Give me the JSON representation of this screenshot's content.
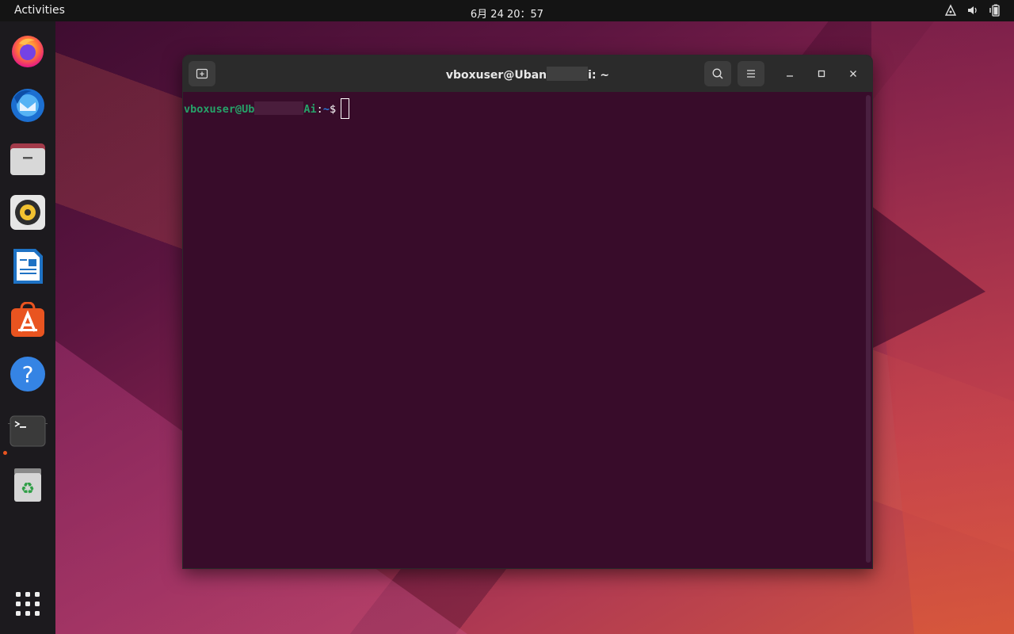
{
  "topbar": {
    "activities_label": "Activities",
    "clock": "6月 24 20：57",
    "tray_icons": [
      "network-icon",
      "volume-icon",
      "battery-icon"
    ]
  },
  "dock": {
    "items": [
      {
        "name": "firefox",
        "icon": "firefox-icon"
      },
      {
        "name": "thunderbird",
        "icon": "thunderbird-icon"
      },
      {
        "name": "files",
        "icon": "files-icon"
      },
      {
        "name": "rhythmbox",
        "icon": "rhythmbox-icon"
      },
      {
        "name": "libreoffice-writer",
        "icon": "writer-icon"
      },
      {
        "name": "ubuntu-software",
        "icon": "software-icon"
      },
      {
        "name": "help",
        "icon": "help-icon"
      },
      {
        "name": "terminal",
        "icon": "terminal-icon",
        "running": true
      },
      {
        "name": "trash",
        "icon": "trash-icon"
      },
      {
        "name": "show-apps",
        "icon": "app-grid-icon"
      }
    ]
  },
  "terminal": {
    "title_prefix": "vboxuser@Uban",
    "title_suffix": "i: ~",
    "prompt_user": "vboxuser@Ub",
    "prompt_host_tail": "Ai",
    "prompt_colon": ":",
    "prompt_path": "~",
    "prompt_symbol": "$"
  },
  "colors": {
    "accent": "#e95420",
    "terminal_bg": "#380c2a",
    "prompt_user": "#26a269",
    "prompt_path": "#2a7bde"
  }
}
